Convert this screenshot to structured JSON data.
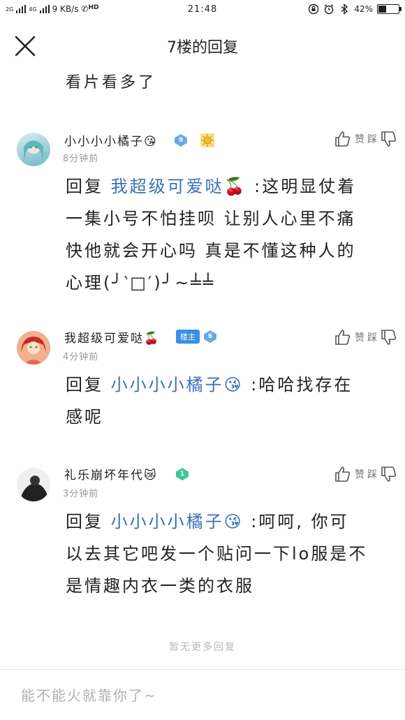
{
  "status": {
    "network": "2G",
    "network2": "4G",
    "speed": "9 KB/s",
    "hd": "HD",
    "time": "21:48",
    "battery": "42%"
  },
  "header": {
    "title": "7楼的回复"
  },
  "top_text": "看片看多了",
  "comments": [
    {
      "username": "小小小小橘子",
      "name_emoji": "😘",
      "level": "9",
      "time": "8分钟前",
      "like_label": "赞",
      "dislike_label": "踩",
      "reply_word": "回复",
      "mention": "我超级可爱哒🍒",
      "lines": [
        "回复 我超级可爱哒🍒 :这明显仗着",
        "一集小号不怕挂呗 让别人心里不痛",
        "快他就会开心吗 真是不懂这种人的",
        "心理(╯‵□′)╯~╧╧"
      ]
    },
    {
      "username": "我超级可爱哒",
      "name_emoji": "🍒",
      "louzhu": "楼主",
      "level": "6",
      "time": "4分钟前",
      "like_label": "赞",
      "dislike_label": "踩",
      "lines": [
        "回复 小小小小橘子😘 :哈哈找存在",
        "感呢"
      ]
    },
    {
      "username": "礼乐崩坏年代",
      "name_emoji": "😿",
      "level": "1",
      "time": "3分钟前",
      "like_label": "赞",
      "dislike_label": "踩",
      "lines": [
        "回复 小小小小橘子😘 :呵呵, 你可",
        "以去其它吧发一个贴问一下lo服是不",
        "是情趣内衣一类的衣服"
      ]
    }
  ],
  "no_more": "暂无更多回复",
  "input": {
    "placeholder": "能不能火就靠你了~"
  },
  "colors": {
    "mention": "#3b6fb6",
    "louzhu_badge": "#3a8ee6",
    "muted": "#999999"
  }
}
